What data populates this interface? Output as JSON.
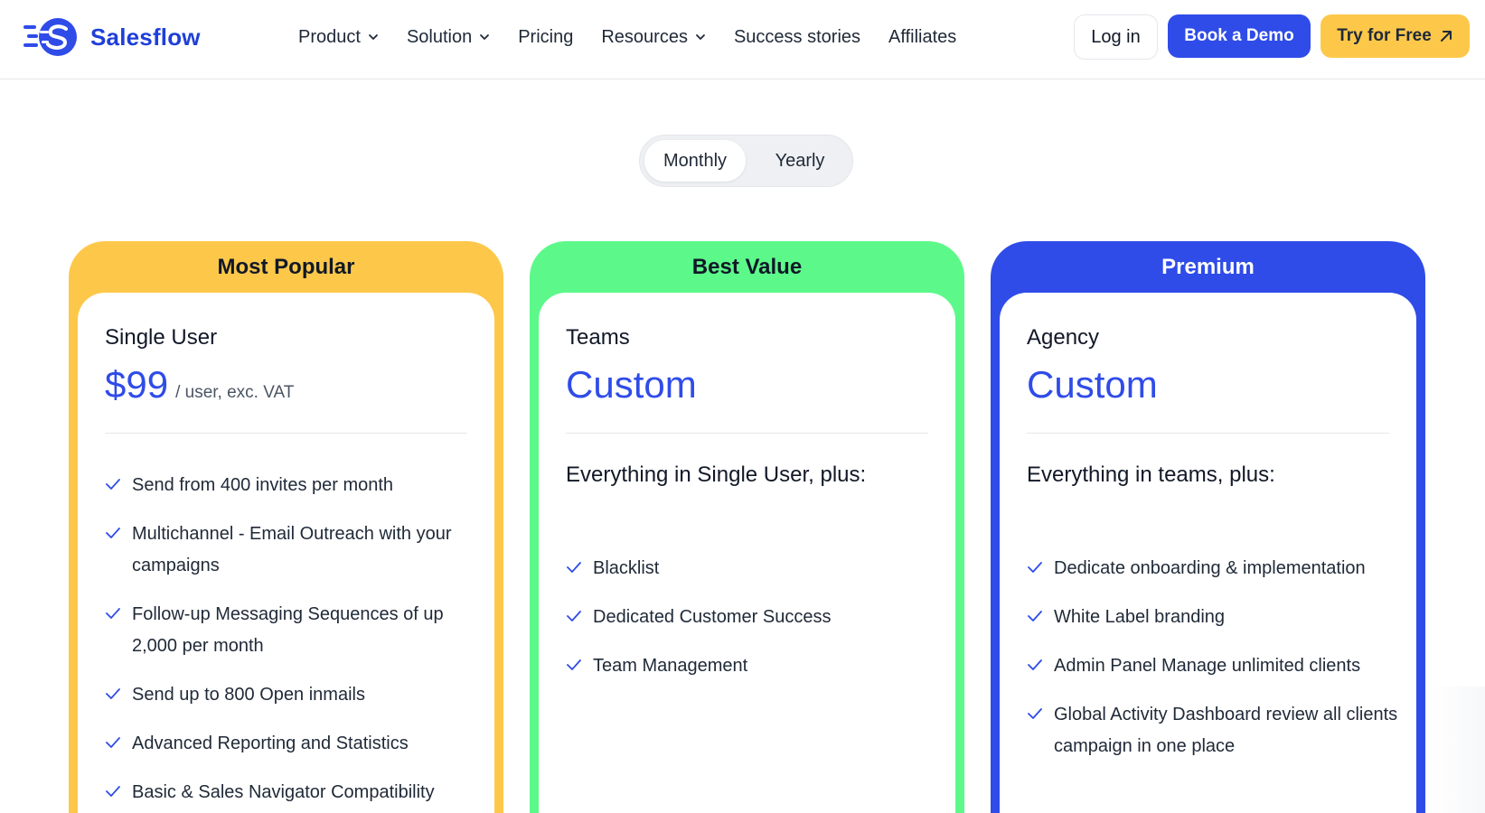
{
  "brand": {
    "name": "Salesflow",
    "color": "#1f3fd8"
  },
  "nav": {
    "items": [
      {
        "label": "Product",
        "dropdown": true
      },
      {
        "label": "Solution",
        "dropdown": true
      },
      {
        "label": "Pricing",
        "dropdown": false
      },
      {
        "label": "Resources",
        "dropdown": true
      },
      {
        "label": "Success stories",
        "dropdown": false
      },
      {
        "label": "Affiliates",
        "dropdown": false
      }
    ]
  },
  "header_actions": {
    "login": "Log in",
    "demo": "Book a Demo",
    "free": "Try for Free"
  },
  "billing_toggle": {
    "options": [
      "Monthly",
      "Yearly"
    ],
    "selected": "Monthly"
  },
  "plans": [
    {
      "banner": "Most Popular",
      "name": "Single User",
      "price": "$99",
      "price_note": "/ user, exc. VAT",
      "accent": "#fdc84a",
      "features": [
        "Send from 400 invites per month",
        "Multichannel - Email Outreach with your campaigns",
        "Follow-up Messaging Sequences of up 2,000 per month",
        "Send up to 800 Open inmails",
        "Advanced Reporting and Statistics",
        "Basic & Sales Navigator Compatibility"
      ]
    },
    {
      "banner": "Best Value",
      "name": "Teams",
      "price": "Custom",
      "everything": "Everything in Single User, plus:",
      "accent": "#5cf98a",
      "features": [
        "Blacklist",
        "Dedicated Customer Success",
        "Team Management"
      ]
    },
    {
      "banner": "Premium",
      "name": "Agency",
      "price": "Custom",
      "everything": "Everything in teams, plus:",
      "accent": "#2f4ce8",
      "features": [
        "Dedicate onboarding & implementation",
        "White Label branding",
        "Admin Panel Manage unlimited clients",
        "Global Activity Dashboard review all clients campaign in one place"
      ]
    }
  ],
  "colors": {
    "primary_blue": "#2f4ce8",
    "yellow": "#fdc84a",
    "green": "#5cf98a"
  },
  "icons": [
    "logo-mark",
    "chevron-down-icon",
    "arrow-up-right-icon",
    "check-icon"
  ]
}
